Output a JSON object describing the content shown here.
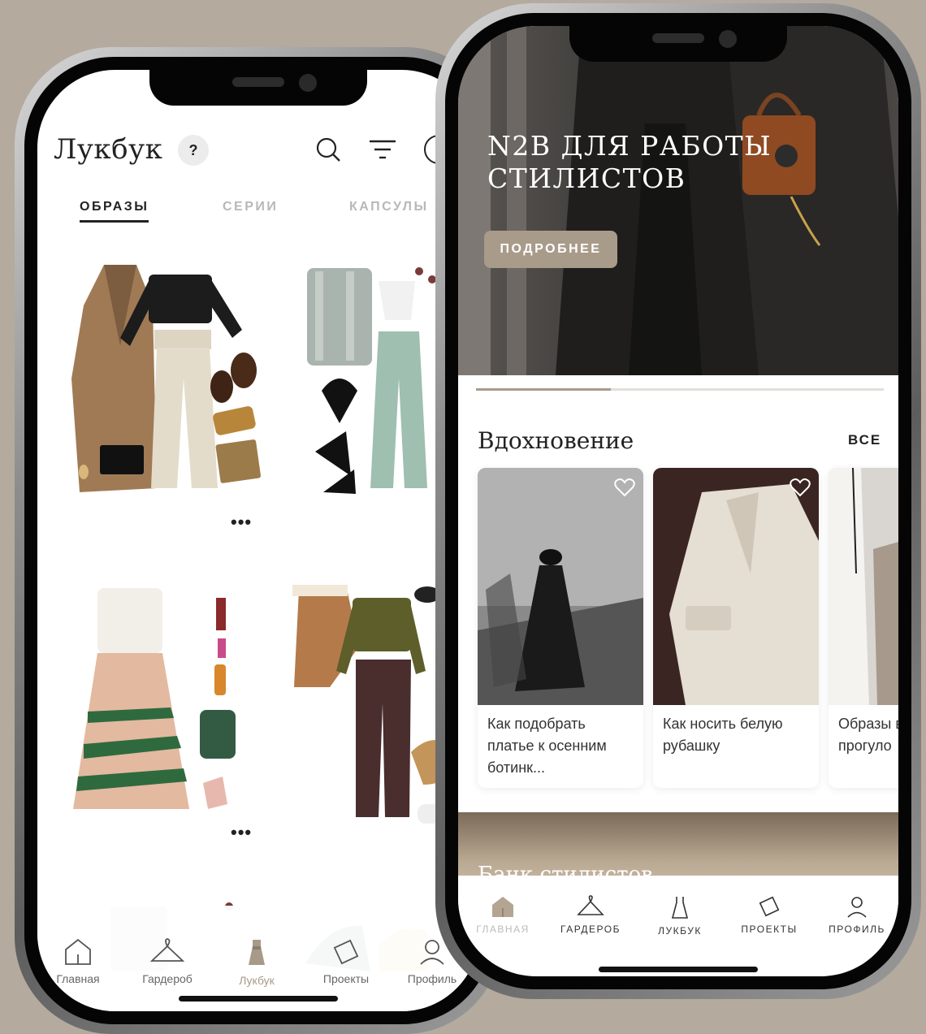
{
  "left_app": {
    "title": "Лукбук",
    "help": "?",
    "tabs": [
      "ОБРАЗЫ",
      "СЕРИИ",
      "КАПСУЛЫ"
    ],
    "more": "•••",
    "tabbar": [
      "Главная",
      "Гардероб",
      "Лукбук",
      "Проекты",
      "Профиль"
    ],
    "active_tab": "Лукбук"
  },
  "right_app": {
    "hero_title": "N2B ДЛЯ РАБОТЫ СТИЛИСТОВ",
    "hero_button": "ПОДРОБНЕЕ",
    "carousel_progress": 0.33,
    "section_title": "Вдохновение",
    "section_all": "ВСЕ",
    "cards": [
      "Как подобрать платье к осенним ботинк...",
      "Как носить белую рубашку",
      "Образы вечерни прогуло"
    ],
    "bank_title": "Банк стилистов",
    "tabbar": [
      "ГЛАВНАЯ",
      "ГАРДЕРОБ",
      "ЛУКБУК",
      "ПРОЕКТЫ",
      "ПРОФИЛЬ"
    ],
    "active_tab": "ГЛАВНАЯ"
  },
  "colors": {
    "background": "#b4aa9e",
    "accent": "#a99b8a",
    "text": "#222222"
  }
}
